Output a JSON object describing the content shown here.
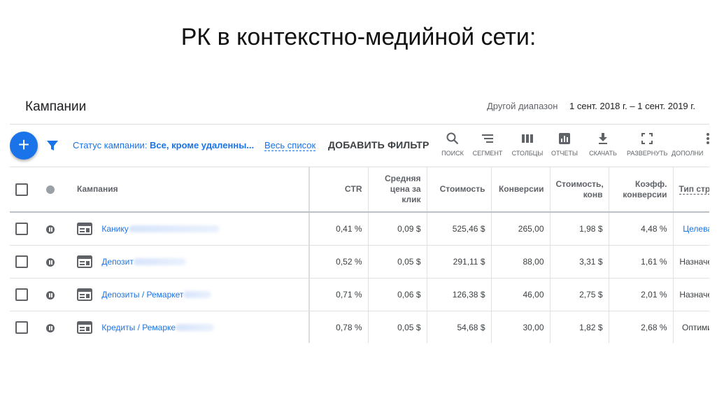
{
  "slide": {
    "title": "РК в контекстно-медийной сети:"
  },
  "header": {
    "title": "Кампании",
    "range_label": "Другой диапазон",
    "range_value": "1 сент. 2018 г. – 1 сент. 2019 г."
  },
  "toolbar": {
    "add_label": "+",
    "status_prefix": "Статус кампании: ",
    "status_value": "Все, кроме удаленны...",
    "full_list": "Весь список",
    "add_filter": "ДОБАВИТЬ ФИЛЬТР",
    "tools": {
      "search": "ПОИСК",
      "segment": "СЕГМЕНТ",
      "columns": "СТОЛБЦЫ",
      "reports": "ОТЧЕТЫ",
      "download": "СКАЧАТЬ",
      "expand": "РАЗВЕРНУТЬ",
      "more": "ДОПОЛНИ"
    }
  },
  "table": {
    "headers": {
      "campaign": "Кампания",
      "ctr": "CTR",
      "avg_cpc_1": "Средняя",
      "avg_cpc_2": "цена за",
      "avg_cpc_3": "клик",
      "cost": "Стоимость",
      "conversions": "Конверсии",
      "cost_conv_1": "Стоимость,",
      "cost_conv_2": "конв",
      "conv_rate_1": "Коэфф.",
      "conv_rate_2": "конверсии",
      "bid_type": "Тип стр"
    },
    "rows": [
      {
        "name": "Канику",
        "ctr": "0,41 %",
        "cpc": "0,09 $",
        "cost": "525,46 $",
        "conv": "265,00",
        "cost_conv": "1,98 $",
        "conv_rate": "4,48 %",
        "type": "Целева"
      },
      {
        "name": "Депозит",
        "ctr": "0,52 %",
        "cpc": "0,05 $",
        "cost": "291,11 $",
        "conv": "88,00",
        "cost_conv": "3,31 $",
        "conv_rate": "1,61 %",
        "type": "Назначе"
      },
      {
        "name": "Депозиты / Ремаркет",
        "ctr": "0,71 %",
        "cpc": "0,06 $",
        "cost": "126,38 $",
        "conv": "46,00",
        "cost_conv": "2,75 $",
        "conv_rate": "2,01 %",
        "type": "Назначе"
      },
      {
        "name": "Кредиты / Ремарке",
        "ctr": "0,78 %",
        "cpc": "0,05 $",
        "cost": "54,68 $",
        "conv": "30,00",
        "cost_conv": "1,82 $",
        "conv_rate": "2,68 %",
        "type": "Оптими"
      }
    ]
  },
  "colors": {
    "accent": "#1a73e8",
    "text": "#202124",
    "muted": "#5f6368"
  }
}
